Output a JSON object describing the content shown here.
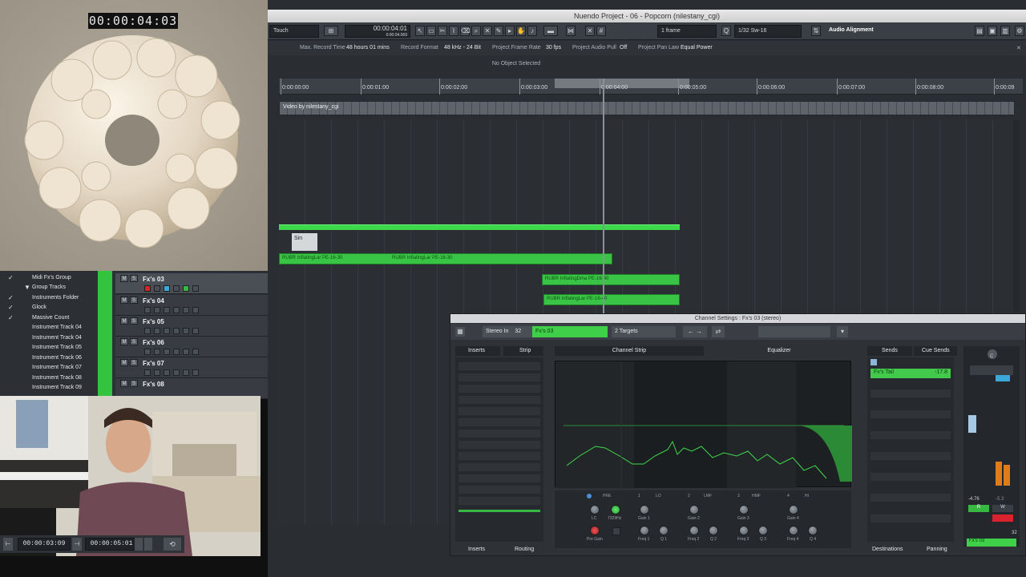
{
  "video": {
    "timecode": "00:00:04:03"
  },
  "window": {
    "title": "Nuendo Project - 06 - Popcorn (nilestany_cgi)"
  },
  "toolbar": {
    "automation_mode": "Touch",
    "position_primary": "00:00:04:01",
    "position_secondary": "0:00:04.069",
    "nudge": "1 frame",
    "quantize": "1/32 Sw-16",
    "audio_alignment": "Audio Alignment"
  },
  "info_line": {
    "max_record_label": "Max. Record Time",
    "max_record_value": "48 hours 01 mins",
    "record_format_label": "Record Format",
    "record_format_value": "48 kHz - 24 Bit",
    "frame_rate_label": "Project Frame Rate",
    "frame_rate_value": "30 fps",
    "audio_pull_label": "Project Audio Pull",
    "audio_pull_value": "Off",
    "pan_law_label": "Project Pan Law",
    "pan_law_value": "Equal Power"
  },
  "selection_status": "No Object Selected",
  "ruler": {
    "labels": [
      "0:00:00:00",
      "0:00:01:00",
      "0:00:02:00",
      "0:00:03:00",
      "0:00:04:00",
      "0:00:05:00",
      "0:00:06:00",
      "0:00:07:00",
      "0:00:08:00",
      "0:00:09"
    ]
  },
  "video_track_label": "Video by nilestany_cgi",
  "events": {
    "sin_label": "Sin",
    "wave1": "RUBR InflatingLar PE-16-30",
    "wave1b": "RUBR InflatingLar PE-16-30",
    "wave2": "RUBR InflatingDma PE-16-40",
    "wave3": "RUBR InflatingLar PE-16-40"
  },
  "tracklist": {
    "left_items": [
      {
        "check": "✓",
        "label": "Midi Fx's Group"
      },
      {
        "check": "▼",
        "label": "Group Tracks"
      },
      {
        "check": "✓",
        "label": "Instruments Folder"
      },
      {
        "check": "✓",
        "label": "Glock"
      },
      {
        "check": "✓",
        "label": "Massive Count"
      },
      {
        "check": "",
        "label": "Instrument Track 04"
      },
      {
        "check": "",
        "label": "Instrument Track 04"
      },
      {
        "check": "",
        "label": "Instrument Track 05"
      },
      {
        "check": "",
        "label": "Instrument Track 06"
      },
      {
        "check": "",
        "label": "Instrument Track 07"
      },
      {
        "check": "",
        "label": "Instrument Track 08"
      },
      {
        "check": "",
        "label": "Instrument Track 09"
      }
    ],
    "mix_tracks": [
      "Fx's 03",
      "Fx's 04",
      "Fx's 05",
      "Fx's 06",
      "Fx's 07",
      "Fx's 08"
    ]
  },
  "transport": {
    "left_locator": "00:00:03:09",
    "right_locator": "00:00:05:01"
  },
  "channel_settings": {
    "title": "Channel Settings : Fx's 03 (stereo)",
    "input": "Stereo In",
    "input_num": "32",
    "channel_name": "Fx's 03",
    "targets": "2 Targets",
    "inserts_tab": "Inserts",
    "strip_tab": "Strip",
    "channel_strip_tab": "Channel Strip",
    "equalizer_tab": "Equalizer",
    "sends_tab": "Sends",
    "cue_sends_tab": "Cue Sends",
    "send_name": "Fx's Tail",
    "send_value": "-17.8",
    "bottom_inserts": "Inserts",
    "bottom_routing": "Routing",
    "bottom_destinations": "Destinations",
    "bottom_panning": "Panning",
    "pre_label": "PRE",
    "lc_value": "7329Hz",
    "lc_label": "LC",
    "pre_gain_label": "Pre Gain",
    "band_labels": [
      "1",
      "LO",
      "2",
      "LMF",
      "3",
      "HMF",
      "4",
      "HI"
    ],
    "gain_labels": [
      "Gain 1",
      "Gain 2",
      "Gain 3",
      "Gain 4"
    ],
    "freq_labels": [
      "Freq 1",
      "Q 1",
      "Freq 2",
      "Q 2",
      "Freq 3",
      "Q 3",
      "Freq 4",
      "Q 4"
    ],
    "meter_readouts": [
      "-4.76",
      "-5.3"
    ],
    "meter_channel_label": "Fx's 03",
    "meter_num": "32",
    "meter_c": "C"
  },
  "colors": {
    "accent_green": "#3ed94a",
    "bg_dark": "#2a2e33"
  }
}
